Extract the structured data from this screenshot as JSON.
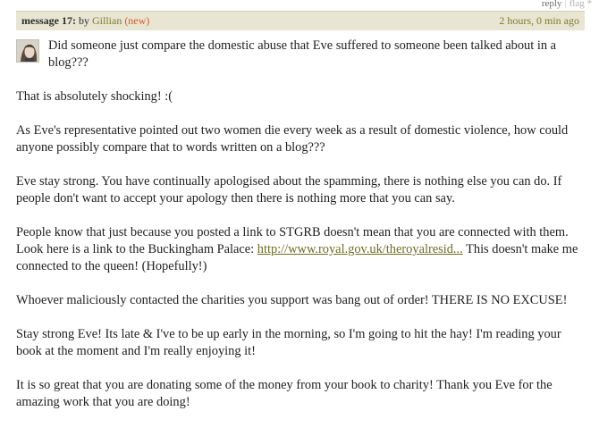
{
  "top_links": {
    "reply": "reply",
    "separator": "|",
    "flag": "flag *"
  },
  "message": {
    "label": "message 17:",
    "by": "by",
    "author": "Gillian",
    "new_badge": "(new)",
    "time_ago": "2 hours, 0 min ago",
    "paragraphs": [
      "Did someone just compare the domestic abuse that Eve suffered to someone been talked about in a blog???",
      "That is absolutely shocking! :(",
      "As Eve's representative pointed out two women die every week as a result of domestic violence, how could anyone possibly compare that to words written on a blog???",
      "Eve stay strong. You have continually apologised about the spamming, there is nothing else you can do. If people don't want to accept your apology then there is nothing more that you can say.",
      "People know that just because you posted a link to STGRB doesn't mean that you are connected with them. Look here is a link to the Buckingham Palace:",
      "Whoever maliciously contacted the charities you support was bang out of order! THERE IS NO EXCUSE!",
      "Stay strong Eve! Its late & I've to be up early in the morning, so I'm going to hit the hay! I'm reading your book at the moment and I'm really enjoying it!",
      "It is so great that you are donating some of the money from your book to charity! Thank you Eve for the amazing work that you are doing!"
    ],
    "link_text": "http://www.royal.gov.uk/theroyalresid...",
    "link_after": "This doesn't make me connected to the queen! (Hopefully!)"
  },
  "colors": {
    "header_bg": "#e8e6d2",
    "author": "#7a7b2f",
    "new_badge": "#d25a2c",
    "link": "#6d6d22"
  }
}
